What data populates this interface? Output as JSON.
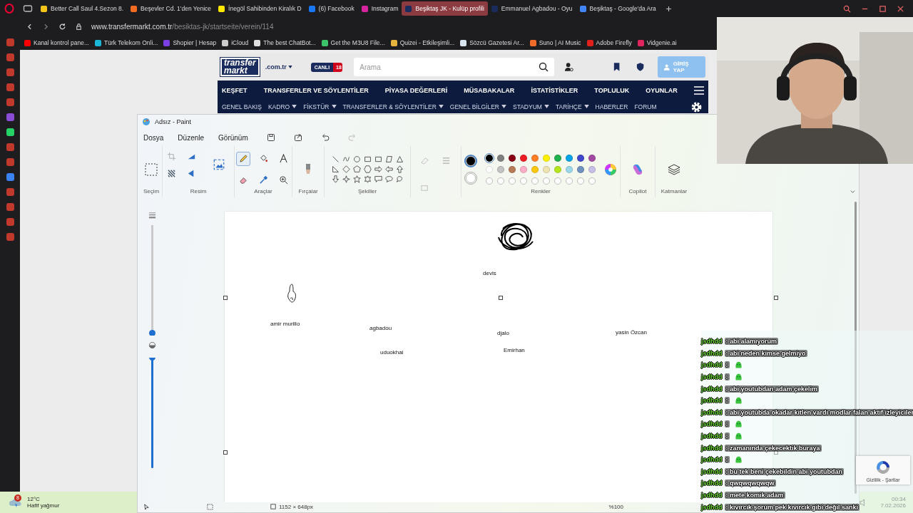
{
  "browser": {
    "tabs": [
      {
        "title": "Better Call Saul 4.Sezon 8.",
        "selected": false,
        "color": "#f5c518"
      },
      {
        "title": "Beşevler Cd. 1'den Yenice",
        "selected": false,
        "color": "#f26b21"
      },
      {
        "title": "İnegöl Sahibinden Kiralık D",
        "selected": false,
        "color": "#ffe800"
      },
      {
        "title": "(6) Facebook",
        "selected": false,
        "color": "#1877f2"
      },
      {
        "title": "Instagram",
        "selected": false,
        "color": "#d6249f"
      },
      {
        "title": "Beşiktaş JK - Kulüp profili",
        "selected": true,
        "color": "#1a2b5e"
      },
      {
        "title": "Emmanuel Agbadou - Oyu",
        "selected": false,
        "color": "#1a2b5e"
      },
      {
        "title": "Beşiktaş - Google'da Ara",
        "selected": false,
        "color": "#4285f4"
      }
    ],
    "url_host": "www.transfermarkt.com.tr",
    "url_path": "/besiktas-jk/startseite/verein/114",
    "bookmarks": [
      {
        "title": "Kanal kontrol pane...",
        "color": "#ff0000"
      },
      {
        "title": "Türk Telekom Onli...",
        "color": "#19b8d8"
      },
      {
        "title": "Shopier | Hesap",
        "color": "#7b3fe4"
      },
      {
        "title": "iCloud",
        "color": "#cccccc"
      },
      {
        "title": "The best ChatBot...",
        "color": "#e0e0e0"
      },
      {
        "title": "Get the M3U8 File...",
        "color": "#3cc46a"
      },
      {
        "title": "Quizei - Etkileşimli...",
        "color": "#e8b33c"
      },
      {
        "title": "Sözcü Gazetesi Ar...",
        "color": "#d8e4f0"
      },
      {
        "title": "Suno | AI Music",
        "color": "#f06a2a"
      },
      {
        "title": "Adobe Firefly",
        "color": "#e0201b"
      },
      {
        "title": "Vidgenie.ai",
        "color": "#e0245e"
      }
    ]
  },
  "site": {
    "logo_top": "transfer",
    "logo_bottom": "markt",
    "domain": ".com.tr",
    "live_label": "CANLI",
    "live_count": "18",
    "search_placeholder": "Arama",
    "login": "GİRİŞ YAP",
    "nav": [
      "KEŞFET",
      "TRANSFERLER VE SÖYLENTİLER",
      "PİYASA DEĞERLERİ",
      "MÜSABAKALAR",
      "İSTATİSTİKLER",
      "TOPLULUK",
      "OYUNLAR"
    ],
    "subnav": [
      {
        "label": "GENEL BAKIŞ",
        "dropdown": false
      },
      {
        "label": "KADRO",
        "dropdown": true
      },
      {
        "label": "FİKSTÜR",
        "dropdown": true
      },
      {
        "label": "TRANSFERLER & SÖYLENTİLER",
        "dropdown": true
      },
      {
        "label": "GENEL BİLGİLER",
        "dropdown": true
      },
      {
        "label": "STADYUM",
        "dropdown": true
      },
      {
        "label": "TARİHÇE",
        "dropdown": true
      },
      {
        "label": "HABERLER",
        "dropdown": false
      },
      {
        "label": "FORUM",
        "dropdown": false
      }
    ]
  },
  "paint": {
    "title": "Adsız - Paint",
    "menu": [
      "Dosya",
      "Düzenle",
      "Görünüm"
    ],
    "groups": [
      "Seçim",
      "Resim",
      "Araçlar",
      "Fırçalar",
      "Şekiller",
      "Renkler",
      "Copilot",
      "Katmanlar"
    ],
    "colors": [
      {
        "color": "#000000",
        "selected": true
      },
      {
        "color": "#7f7f7f",
        "selected": false
      },
      {
        "color": "#880015",
        "selected": false
      },
      {
        "color": "#ed1c24",
        "selected": false
      },
      {
        "color": "#ff7f27",
        "selected": false
      },
      {
        "color": "#fff200",
        "selected": false
      },
      {
        "color": "#22b14c",
        "selected": false
      },
      {
        "color": "#00a2e8",
        "selected": false
      },
      {
        "color": "#3f48cc",
        "selected": false
      },
      {
        "color": "#a349a4",
        "selected": false
      },
      {
        "color": "#ffffff",
        "selected": false
      },
      {
        "color": "#c3c3c3",
        "selected": false
      },
      {
        "color": "#b97a57",
        "selected": false
      },
      {
        "color": "#ffaec9",
        "selected": false
      },
      {
        "color": "#ffc90e",
        "selected": false
      },
      {
        "color": "#efe4b0",
        "selected": false
      },
      {
        "color": "#b5e61d",
        "selected": false
      },
      {
        "color": "#99d9ea",
        "selected": false
      },
      {
        "color": "#7092be",
        "selected": false
      },
      {
        "color": "#c8bfe7",
        "selected": false
      }
    ],
    "size_slider": {
      "level": 0.02
    },
    "opacity_slider": {
      "level": 1
    },
    "canvas_labels": [
      "devis",
      "amir murillo",
      "agbadou",
      "uduokhai",
      "djalo",
      "Emirhan",
      "yasin Özcan"
    ],
    "canvas_size": "1152 × 648px",
    "zoom": "%100"
  },
  "chat": [
    {
      "kind": "text",
      "user": "jsdhdd",
      "text": ": abi alamıyorum"
    },
    {
      "kind": "text",
      "user": "jsdhdd",
      "text": ": abi neden kimse gelmiyo"
    },
    {
      "kind": "emoji",
      "user": "jsdhdd",
      "text": ":"
    },
    {
      "kind": "emoji",
      "user": "jsdhdd",
      "text": ":"
    },
    {
      "kind": "text",
      "user": "jsdhdd",
      "text": ": abi youtubdan adam çekelim"
    },
    {
      "kind": "emoji",
      "user": "jsdhdd",
      "text": ":"
    },
    {
      "kind": "text",
      "user": "jsdhdd",
      "text": ": abi youtubda okadar kitlen vardı modlar falan aktif izleyiciler"
    },
    {
      "kind": "emoji",
      "user": "jsdhdd",
      "text": ":"
    },
    {
      "kind": "emoji",
      "user": "jsdhdd",
      "text": ":"
    },
    {
      "kind": "text",
      "user": "jsdhdd",
      "text": ": zamanında çekecektik buraya"
    },
    {
      "kind": "emoji",
      "user": "jsdhdd",
      "text": ":"
    },
    {
      "kind": "text",
      "user": "jsdhdd",
      "text": ": bu tek beni çekebildin abi youtubdan"
    },
    {
      "kind": "text",
      "user": "jsdhdd",
      "text": ": qwqwqwqwqw"
    },
    {
      "kind": "text",
      "user": "jsdhdd",
      "text": ": mete komik adam"
    },
    {
      "kind": "text",
      "user": "jsdhdd",
      "text": ": kıvırcık şorum pek kıvırcık gibi değil sanki"
    }
  ],
  "recaptcha": "Gizlilik - Şartlar",
  "taskbar": {
    "weather_badge": "8",
    "temperature": "12°C",
    "weather": "Hafif yağmur",
    "time": "00:34",
    "date": "7.02.2026"
  }
}
